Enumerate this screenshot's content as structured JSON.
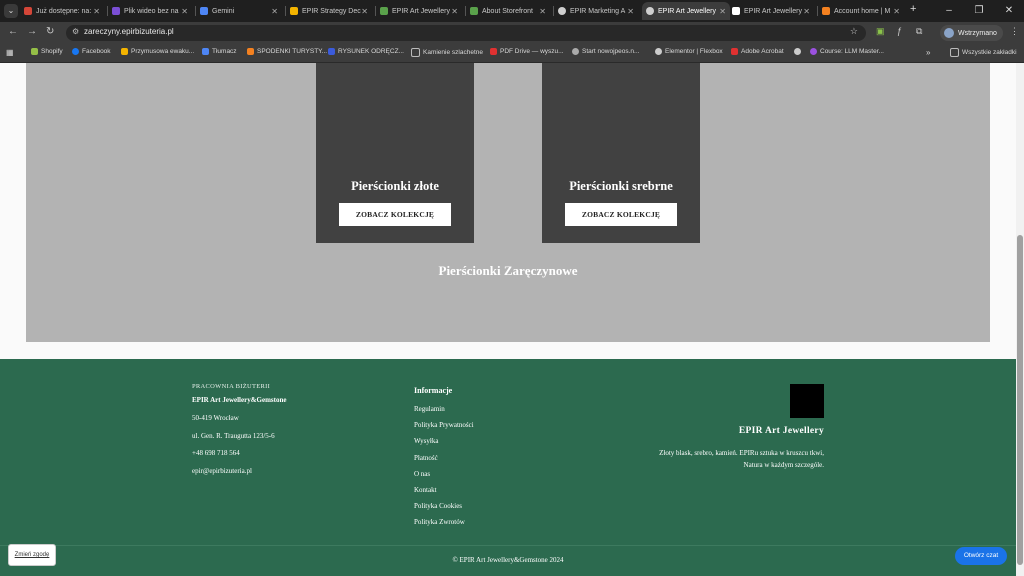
{
  "browser": {
    "tabs": [
      {
        "title": "Już dostępne: na:",
        "color": "#d44638"
      },
      {
        "title": "Plik wideo bez na",
        "color": "#7b4fd6"
      },
      {
        "title": "Gemini",
        "color": "#4e86f5"
      },
      {
        "title": "EPIR Strategy Dec",
        "color": "#f4b400"
      },
      {
        "title": "EPIR Art Jewellery",
        "color": "#5aa24b"
      },
      {
        "title": "About Storefront",
        "color": "#5aa24b"
      },
      {
        "title": "EPIR Marketing A",
        "color": "#cfcfcf"
      },
      {
        "title": "EPIR Art Jewellery",
        "color": "#cfcfcf"
      },
      {
        "title": "EPIR Art Jewellery",
        "color": "#ffffff"
      },
      {
        "title": "Account home | M",
        "color": "#f48120"
      }
    ],
    "new_tab": "+",
    "window_controls": {
      "minimize": "–",
      "maximize": "❐",
      "close": "✕"
    },
    "url": "zareczyny.epirbizuteria.pl",
    "profile_label": "Wstrzymano",
    "bookmarks": [
      {
        "label": "Shopify",
        "color": "#95bf47"
      },
      {
        "label": "Facebook",
        "color": "#1877f2"
      },
      {
        "label": "Przymusowa ewaku...",
        "color": "#f4b400"
      },
      {
        "label": "Tłumacz",
        "color": "#4e86f5"
      },
      {
        "label": "SPODENKI TURYSTY...",
        "color": "#f48120"
      },
      {
        "label": "RYSUNEK ODRĘCZ...",
        "color": "#3b5bdb"
      },
      {
        "label": "Kamienie szlachetne",
        "color": "#888888"
      },
      {
        "label": "PDF Drive — wyszu...",
        "color": "#e03131"
      },
      {
        "label": "Start nowojpeos.n...",
        "color": "#aaaaaa"
      },
      {
        "label": "Elementor | Flexbox",
        "color": "#cccccc"
      },
      {
        "label": "Adobe Acrobat",
        "color": "#e03131"
      },
      {
        "label": "",
        "color": "#cccccc"
      },
      {
        "label": "Course: LLM Master...",
        "color": "#9b51e0"
      }
    ],
    "bookmarks_more": "»",
    "all_bookmarks": "Wszystkie zakładki"
  },
  "collections": {
    "gold": {
      "title": "Pierścionki złote",
      "button": "ZOBACZ KOLEKCJĘ"
    },
    "silver": {
      "title": "Pierścionki srebrne",
      "button": "ZOBACZ KOLEKCJĘ"
    },
    "section_title": "Pierścionki Zaręczynowe"
  },
  "footer": {
    "workshop_label": "PRACOWNIA BIŻUTERII",
    "brand": "EPIR Art Jewellery&Gemstone",
    "postal": "50-419 Wrocław",
    "street": "ul. Gen. R. Traugutta 123/5-6",
    "phone": "+48 698 718 564",
    "email": "epir@epirbizuteria.pl",
    "info_heading": "Informacje",
    "links": [
      "Regulamin",
      "Polityka Prywatności",
      "Wysyłka",
      "Płatność",
      "O nas",
      "Kontakt",
      "Polityka Cookies",
      "Polityka Zwrotów"
    ],
    "logo_title": "EPIR Art Jewellery",
    "tagline_1": "Złoty blask, srebro, kamień. EPIRu sztuka w kruszcu tkwi,",
    "tagline_2": "Natura w każdym szczególe.",
    "copyright": "© EPIR Art Jewellery&Gemstone 2024"
  },
  "widgets": {
    "cookie_button": "Zmień zgodę",
    "chat_button": "Otwórz czat"
  }
}
